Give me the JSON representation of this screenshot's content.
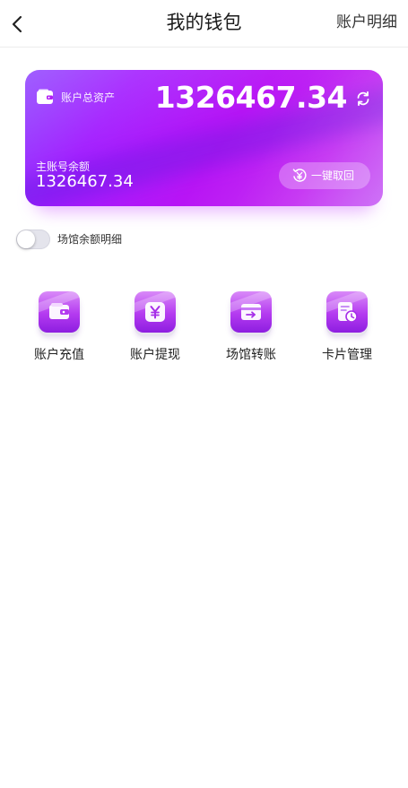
{
  "header": {
    "title": "我的钱包",
    "right_link": "账户明细"
  },
  "card": {
    "total_label": "账户总资产",
    "total_amount": "1326467.34",
    "main_label": "主账号余额",
    "main_amount": "1326467.34",
    "recall_label": "一键取回",
    "icons": [
      "wallet-icon",
      "refresh-icon",
      "yen-recall-icon"
    ],
    "gradient_colors": [
      "#8a3dff",
      "#b814f5",
      "#c65cf5"
    ]
  },
  "toggle": {
    "label": "场馆余额明细",
    "on": false
  },
  "actions": [
    {
      "label": "账户充值",
      "icon": "wallet-icon"
    },
    {
      "label": "账户提现",
      "icon": "yen-icon"
    },
    {
      "label": "场馆转账",
      "icon": "card-transfer-icon"
    },
    {
      "label": "卡片管理",
      "icon": "card-clock-icon"
    }
  ],
  "colors": {
    "accent": "#b13cf2"
  }
}
